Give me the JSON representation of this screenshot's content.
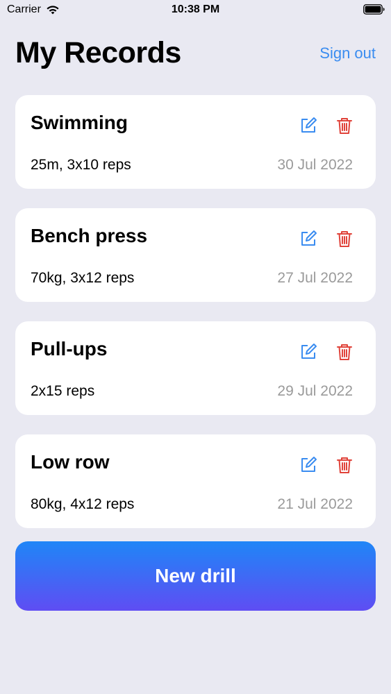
{
  "status_bar": {
    "carrier": "Carrier",
    "time": "10:38 PM",
    "wifi_icon": "wifi-icon",
    "battery_icon": "battery-icon"
  },
  "header": {
    "title": "My Records",
    "sign_out_label": "Sign out"
  },
  "records": [
    {
      "title": "Swimming",
      "detail": "25m, 3x10 reps",
      "date": "30 Jul 2022",
      "edit_icon": "edit-icon",
      "delete_icon": "trash-icon"
    },
    {
      "title": "Bench press",
      "detail": "70kg, 3x12 reps",
      "date": "27 Jul 2022",
      "edit_icon": "edit-icon",
      "delete_icon": "trash-icon"
    },
    {
      "title": "Pull-ups",
      "detail": "2x15 reps",
      "date": "29 Jul 2022",
      "edit_icon": "edit-icon",
      "delete_icon": "trash-icon"
    },
    {
      "title": "Low row",
      "detail": "80kg, 4x12 reps",
      "date": "21 Jul 2022",
      "edit_icon": "edit-icon",
      "delete_icon": "trash-icon"
    }
  ],
  "footer": {
    "new_drill_label": "New drill"
  },
  "colors": {
    "background": "#e9e9f2",
    "card": "#ffffff",
    "accent_blue": "#3a8cf0",
    "delete_red": "#e0433a",
    "date_gray": "#9a9a9a",
    "button_gradient_top": "#1f86f7",
    "button_gradient_bottom": "#5f4df3"
  }
}
